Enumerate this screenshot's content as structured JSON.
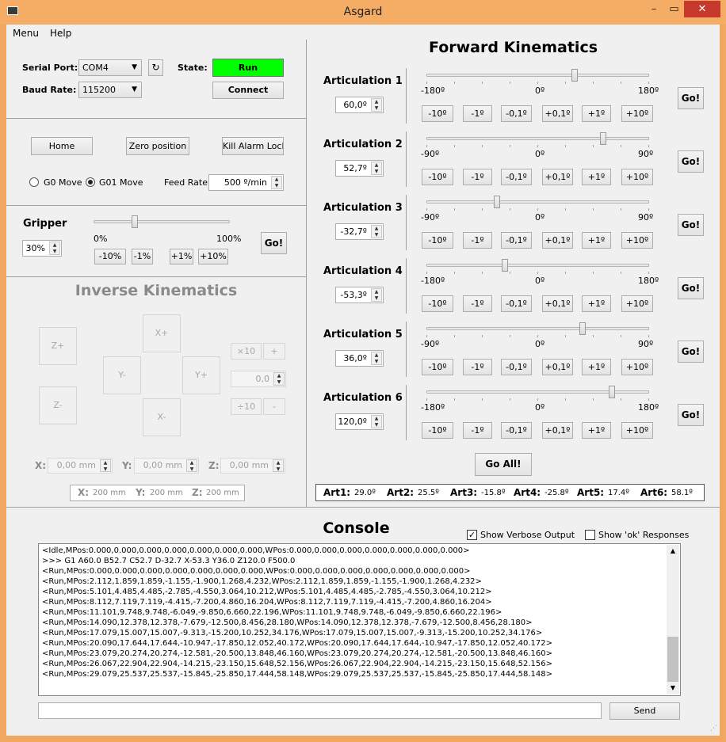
{
  "window": {
    "title": "Asgard",
    "minimize": "–",
    "maximize": "▭",
    "close": "✕"
  },
  "menu": [
    "Menu",
    "Help"
  ],
  "serial": {
    "port_label": "Serial Port:",
    "port_value": "COM4",
    "refresh_icon": "refresh-icon",
    "baud_label": "Baud Rate:",
    "baud_value": "115200",
    "state_label": "State:",
    "state_value": "Run",
    "state_color": "#00ff00",
    "connect": "Connect"
  },
  "machine": {
    "home": "Home",
    "zero": "Zero position",
    "kill": "Kill Alarm Lock",
    "g0": "G0 Move",
    "g01": "G01 Move",
    "feed_label": "Feed Rate",
    "feed_value": "500 º/min"
  },
  "gripper": {
    "title": "Gripper",
    "value": "30%",
    "level": 30,
    "min": "0%",
    "max": "100%",
    "go": "Go!",
    "steps": [
      "-10%",
      "-1%",
      "+1%",
      "+10%"
    ]
  },
  "ik": {
    "title": "Inverse Kinematics",
    "z_plus": "Z+",
    "z_minus": "Z-",
    "x_plus": "X+",
    "x_minus": "X-",
    "y_minus": "Y-",
    "y_plus": "Y+",
    "x10": "×10",
    "plus": "+",
    "step_value": "0,0",
    "div10": "÷10",
    "minus": "-",
    "x_label": "X:",
    "x_value": "0,00 mm",
    "y_label": "Y:",
    "y_value": "0,00 mm",
    "z_label": "Z:",
    "z_value": "0,00 mm",
    "info_x_label": "X:",
    "info_x": "200 mm",
    "info_y_label": "Y:",
    "info_y": "200 mm",
    "info_z_label": "Z:",
    "info_z": "200 mm"
  },
  "fk": {
    "title": "Forward Kinematics",
    "go": "Go!",
    "go_all": "Go All!",
    "steps": [
      "-10º",
      "-1º",
      "-0,1º",
      "+0,1º",
      "+1º",
      "+10º"
    ],
    "articulations": [
      {
        "name": "Articulation 1",
        "value": "60,0º",
        "min_label": "-180º",
        "zero_label": "0º",
        "max_label": "180º",
        "min": -180,
        "max": 180,
        "angle": 60.0
      },
      {
        "name": "Articulation 2",
        "value": "52,7º",
        "min_label": "-90º",
        "zero_label": "0º",
        "max_label": "90º",
        "min": -90,
        "max": 90,
        "angle": 52.7
      },
      {
        "name": "Articulation 3",
        "value": "-32,7º",
        "min_label": "-90º",
        "zero_label": "0º",
        "max_label": "90º",
        "min": -90,
        "max": 90,
        "angle": -32.7
      },
      {
        "name": "Articulation 4",
        "value": "-53,3º",
        "min_label": "-180º",
        "zero_label": "0º",
        "max_label": "180º",
        "min": -180,
        "max": 180,
        "angle": -53.3
      },
      {
        "name": "Articulation 5",
        "value": "36,0º",
        "min_label": "-90º",
        "zero_label": "0º",
        "max_label": "90º",
        "min": -90,
        "max": 90,
        "angle": 36.0
      },
      {
        "name": "Articulation 6",
        "value": "120,0º",
        "min_label": "-180º",
        "zero_label": "0º",
        "max_label": "180º",
        "min": -180,
        "max": 180,
        "angle": 120.0
      }
    ],
    "status": [
      {
        "label": "Art1:",
        "value": "29.0º"
      },
      {
        "label": "Art2:",
        "value": "25.5º"
      },
      {
        "label": "Art3:",
        "value": "-15.8º"
      },
      {
        "label": "Art4:",
        "value": "-25.8º"
      },
      {
        "label": "Art5:",
        "value": "17.4º"
      },
      {
        "label": "Art6:",
        "value": "58.1º"
      }
    ]
  },
  "console": {
    "title": "Console",
    "verbose_label": "Show Verbose Output",
    "verbose_checked": true,
    "ok_label": "Show 'ok' Responses",
    "ok_checked": false,
    "send": "Send",
    "input_value": "",
    "lines": [
      "<Idle,MPos:0.000,0.000,0.000,0.000,0.000,0.000,0.000,WPos:0.000,0.000,0.000,0.000,0.000,0.000,0.000>",
      ">>> G1 A60.0 B52.7 C52.7 D-32.7 X-53.3 Y36.0 Z120.0 F500.0",
      "<Run,MPos:0.000,0.000,0.000,0.000,0.000,0.000,0.000,WPos:0.000,0.000,0.000,0.000,0.000,0.000,0.000>",
      "<Run,MPos:2.112,1.859,1.859,-1.155,-1.900,1.268,4.232,WPos:2.112,1.859,1.859,-1.155,-1.900,1.268,4.232>",
      "<Run,MPos:5.101,4.485,4.485,-2.785,-4.550,3.064,10.212,WPos:5.101,4.485,4.485,-2.785,-4.550,3.064,10.212>",
      "<Run,MPos:8.112,7.119,7.119,-4.415,-7.200,4.860,16.204,WPos:8.112,7.119,7.119,-4.415,-7.200,4.860,16.204>",
      "<Run,MPos:11.101,9.748,9.748,-6.049,-9.850,6.660,22.196,WPos:11.101,9.748,9.748,-6.049,-9.850,6.660,22.196>",
      "<Run,MPos:14.090,12.378,12.378,-7.679,-12.500,8.456,28.180,WPos:14.090,12.378,12.378,-7.679,-12.500,8.456,28.180>",
      "<Run,MPos:17.079,15.007,15.007,-9.313,-15.200,10.252,34.176,WPos:17.079,15.007,15.007,-9.313,-15.200,10.252,34.176>",
      "<Run,MPos:20.090,17.644,17.644,-10.947,-17.850,12.052,40.172,WPos:20.090,17.644,17.644,-10.947,-17.850,12.052,40.172>",
      "<Run,MPos:23.079,20.274,20.274,-12.581,-20.500,13.848,46.160,WPos:23.079,20.274,20.274,-12.581,-20.500,13.848,46.160>",
      "<Run,MPos:26.067,22.904,22.904,-14.215,-23.150,15.648,52.156,WPos:26.067,22.904,22.904,-14.215,-23.150,15.648,52.156>",
      "<Run,MPos:29.079,25.537,25.537,-15.845,-25.850,17.444,58.148,WPos:29.079,25.537,25.537,-15.845,-25.850,17.444,58.148>"
    ]
  }
}
